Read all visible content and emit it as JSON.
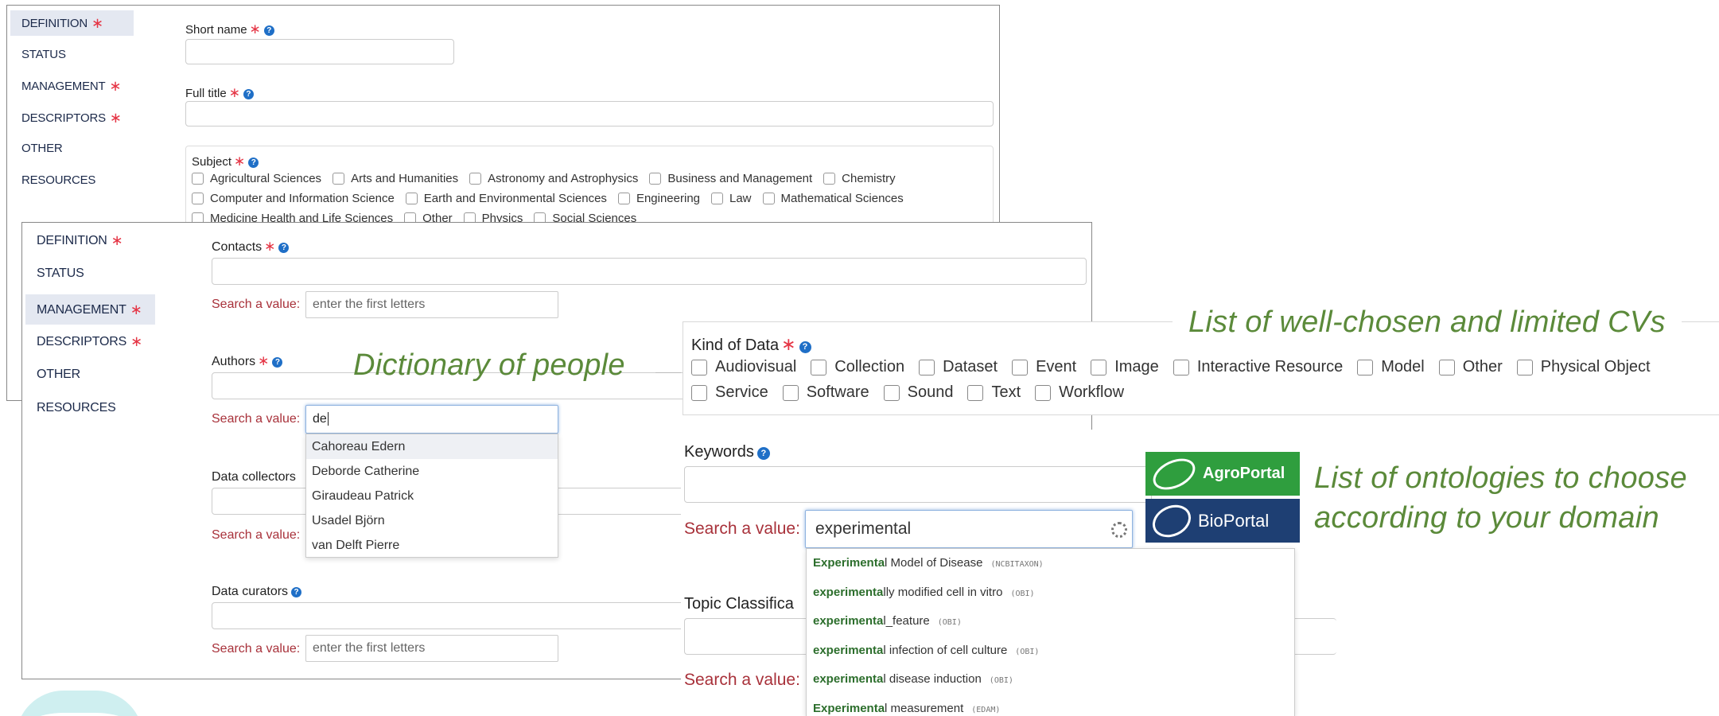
{
  "panel1": {
    "nav": [
      {
        "label": "DEFINITION",
        "required": true,
        "active": true
      },
      {
        "label": "STATUS",
        "required": false,
        "active": false
      },
      {
        "label": "MANAGEMENT",
        "required": true,
        "active": false
      },
      {
        "label": "DESCRIPTORS",
        "required": true,
        "active": false
      },
      {
        "label": "OTHER",
        "required": false,
        "active": false
      },
      {
        "label": "RESOURCES",
        "required": false,
        "active": false
      }
    ],
    "short_name_label": "Short name",
    "full_title_label": "Full title",
    "subject_label": "Subject",
    "subjects_row1": [
      "Agricultural Sciences",
      "Arts and Humanities",
      "Astronomy and Astrophysics",
      "Business and Management",
      "Chemistry"
    ],
    "subjects_row2": [
      "Computer and Information Science",
      "Earth and Environmental Sciences",
      "Engineering",
      "Law",
      "Mathematical Sciences"
    ],
    "subjects_row3": [
      "Medicine Health and Life Sciences",
      "Other",
      "Physics",
      "Social Sciences"
    ]
  },
  "panel2": {
    "nav": [
      {
        "label": "DEFINITION",
        "required": true,
        "active": false
      },
      {
        "label": "STATUS",
        "required": false,
        "active": false
      },
      {
        "label": "MANAGEMENT",
        "required": true,
        "active": true
      },
      {
        "label": "DESCRIPTORS",
        "required": true,
        "active": false
      },
      {
        "label": "OTHER",
        "required": false,
        "active": false
      },
      {
        "label": "RESOURCES",
        "required": false,
        "active": false
      }
    ],
    "contacts_label": "Contacts",
    "authors_label": "Authors",
    "data_collectors_label": "Data collectors",
    "data_curators_label": "Data curators",
    "search_label": "Search a value:",
    "search_placeholder": "enter the first letters",
    "authors_search_value": "de",
    "author_suggestions": [
      "Cahoreau Edern",
      "Deborde Catherine",
      "Giraudeau Patrick",
      "Usadel Björn",
      "van Delft Pierre"
    ]
  },
  "panel3": {
    "kind_of_data_label": "Kind of Data",
    "kinds_row1": [
      "Audiovisual",
      "Collection",
      "Dataset",
      "Event",
      "Image",
      "Interactive Resource",
      "Model",
      "Other",
      "Physical Object"
    ],
    "kinds_row2": [
      "Service",
      "Software",
      "Sound",
      "Text",
      "Workflow"
    ],
    "keywords_label": "Keywords",
    "topic_label": "Topic Classifica",
    "search_label": "Search a value:",
    "keywords_search_value": "experimental",
    "ontology_results": [
      {
        "match": "Experimenta",
        "rest": "l Model of Disease",
        "src": "(NCBITAXON)"
      },
      {
        "match": "experimenta",
        "rest": "lly modified cell in vitro",
        "src": "(OBI)"
      },
      {
        "match": "experimenta",
        "rest": "l_feature",
        "src": "(OBI)"
      },
      {
        "match": "experimenta",
        "rest": "l infection of cell culture",
        "src": "(OBI)"
      },
      {
        "match": "experimenta",
        "rest": "l disease induction",
        "src": "(OBI)"
      },
      {
        "match": "Experimenta",
        "rest": "l measurement",
        "src": "(EDAM)"
      }
    ]
  },
  "callouts": {
    "people": "Dictionary of people",
    "cvs": "List of well-chosen and limited CVs",
    "ontologies_line1": "List of ontologies to choose",
    "ontologies_line2": "according to your domain"
  },
  "logos": {
    "agroportal": "AgroPortal",
    "bioportal": "BioPortal",
    "agro_color": "#2f9e3e",
    "bio_color": "#1e3f73"
  },
  "colors": {
    "required_star": "#e53545",
    "search_label": "#a8313a",
    "callout": "#5b8a3a",
    "help_icon": "#1f6fc7"
  }
}
